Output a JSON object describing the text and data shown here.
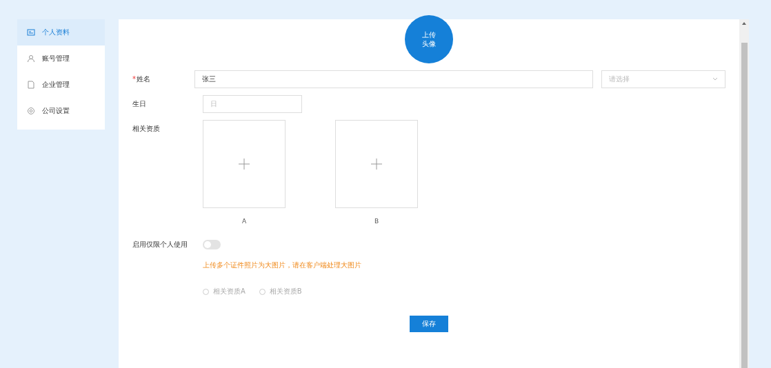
{
  "sidebar": {
    "items": [
      {
        "label": "个人资料",
        "kind": "card",
        "selected": true
      },
      {
        "label": "账号管理",
        "kind": "person",
        "selected": false
      },
      {
        "label": "企业管理",
        "kind": "doc",
        "selected": false
      },
      {
        "label": "公司设置",
        "kind": "gear",
        "selected": false
      }
    ]
  },
  "avatar_button": [
    "上传",
    "头像"
  ],
  "form": {
    "name": {
      "label": "姓名",
      "required_mark": "*",
      "value": "张三"
    },
    "select": {
      "placeholder": "请选择"
    },
    "birthday": {
      "label": "生日",
      "placeholder": "日"
    },
    "qualifications": {
      "label": "相关资质",
      "uploads": [
        {
          "caption": "A"
        },
        {
          "caption": "B"
        }
      ]
    },
    "toggle": {
      "label": "启用仅限个人使用",
      "on": false
    },
    "warning": "上传多个证件照片为大图片，请在客户端处理大图片",
    "radios": [
      {
        "label": "相关资质A",
        "selected": false
      },
      {
        "label": "相关资质B",
        "selected": false
      }
    ],
    "save": "保存"
  }
}
